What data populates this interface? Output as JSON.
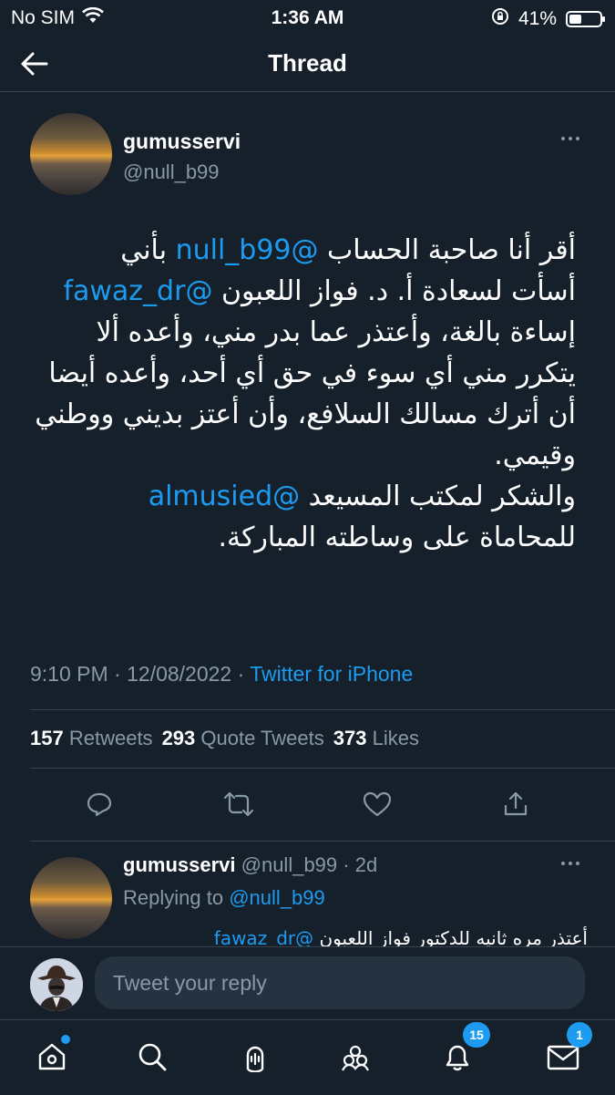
{
  "status_bar": {
    "carrier": "No SIM",
    "time": "1:36 AM",
    "battery_percent_label": "41%",
    "battery_level": 0.41
  },
  "header": {
    "title": "Thread"
  },
  "tweet": {
    "author_name": "gumusservi",
    "author_handle": "@null_b99",
    "text": {
      "l1_a": "أقر أنا صاحبة الحساب ",
      "l1_mention": "@null_b99",
      "l1_b": " بأني",
      "l2_a": "أسأت لسعادة أ. د. فواز اللعبون ",
      "l2_mention": "@fawaz_dr",
      "l3": "إساءة بالغة، وأعتذر عما بدر مني، وأعده ألا",
      "l4": "يتكرر مني أي سوء في حق أي أحد، وأعده أيضا",
      "l5": "أن أترك مسالك السلافع، وأن أعتز بديني ووطني",
      "l6": "وقيمي.",
      "l7_a": "والشكر لمكتب المسيعد ",
      "l7_mention": "@almusied",
      "l8": "للمحاماة على وساطته المباركة."
    },
    "time": "9:10 PM",
    "separator": " · ",
    "date": "12/08/2022",
    "source": "Twitter for iPhone",
    "retweets_count": "157",
    "retweets_label": "Retweets",
    "quotes_count": "293",
    "quotes_label": "Quote Tweets",
    "likes_count": "373",
    "likes_label": "Likes"
  },
  "reply": {
    "author_name": "gumusservi",
    "author_handle": "@null_b99",
    "age": "2d",
    "replying_prefix": "Replying to ",
    "replying_to": "@null_b99",
    "text_a": "أعتذر مره ثانيه للدكتور فواز اللعبون ",
    "text_mention": "@fawaz_dr"
  },
  "composer": {
    "placeholder": "Tweet your reply"
  },
  "tab_bar": {
    "notifications_badge": "15",
    "messages_badge": "1"
  },
  "colors": {
    "background": "#15202b",
    "accent": "#1d9bf0",
    "muted": "#8899a6",
    "border": "#38444d"
  },
  "icons": [
    "wifi-icon",
    "lock-rotation-icon",
    "battery-icon",
    "back-arrow-icon",
    "more-icon",
    "reply-icon",
    "retweet-icon",
    "like-icon",
    "share-icon",
    "home-icon",
    "search-icon",
    "spaces-icon",
    "communities-icon",
    "notifications-icon",
    "messages-icon"
  ]
}
